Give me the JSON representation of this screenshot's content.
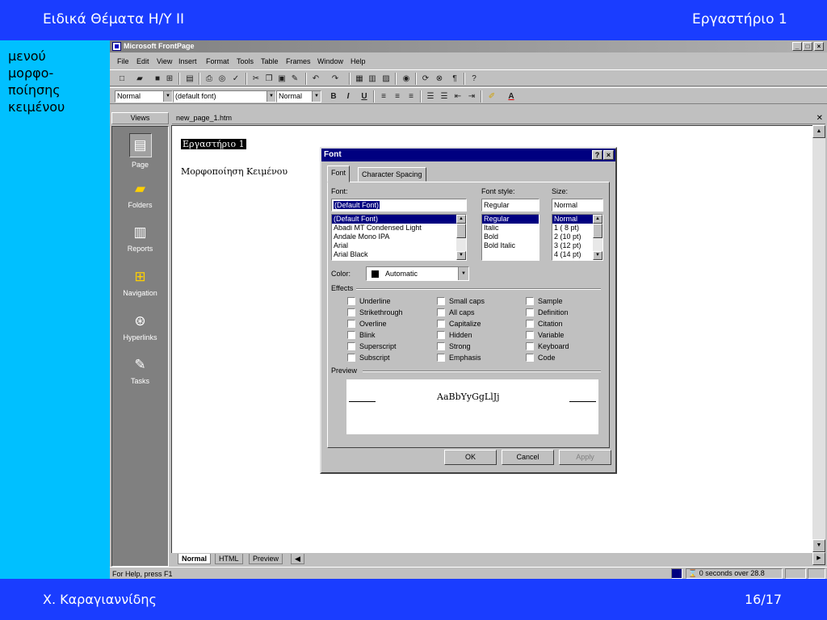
{
  "slide": {
    "header_left": "Ειδικά Θέματα Η/Υ ΙΙ",
    "header_right": "Εργαστήριο 1",
    "side_text": [
      "μενού",
      "μορφο-",
      "ποίησης",
      "κειμένου"
    ],
    "footer_left": "Χ. Καραγιαννίδης",
    "footer_right": "16/17"
  },
  "window": {
    "title": "Microsoft FrontPage",
    "controls": [
      "_",
      "□",
      "×"
    ]
  },
  "menu": [
    "File",
    "Edit",
    "View",
    "Insert",
    "Format",
    "Tools",
    "Table",
    "Frames",
    "Window",
    "Help"
  ],
  "format_toolbar": {
    "style": "Normal",
    "font": "(default font)",
    "size": "Normal",
    "bold": "B",
    "italic": "I",
    "underline": "U"
  },
  "views": {
    "header": "Views",
    "items": [
      "Page",
      "Folders",
      "Reports",
      "Navigation",
      "Hyperlinks",
      "Tasks"
    ]
  },
  "document": {
    "tab": "new_page_1.htm",
    "heading": "Εργαστήριο 1",
    "paragraph": "Μορφοποίηση Κειμένου",
    "bottom_tabs": [
      "Normal",
      "HTML",
      "Preview"
    ]
  },
  "status": {
    "help": "For Help, press F1",
    "timer": "0 seconds over 28.8"
  },
  "dialog": {
    "title": "Font",
    "tabs": [
      "Font",
      "Character Spacing"
    ],
    "font_label": "Font:",
    "font_value": "(Default Font)",
    "font_list": [
      "(Default Font)",
      "Abadi MT Condensed Light",
      "Andale Mono IPA",
      "Arial",
      "Arial Black"
    ],
    "style_label": "Font style:",
    "style_value": "Regular",
    "style_list": [
      "Regular",
      "Italic",
      "Bold",
      "Bold Italic"
    ],
    "size_label": "Size:",
    "size_value": "Normal",
    "size_list": [
      "Normal",
      "1  ( 8 pt)",
      "2  (10 pt)",
      "3  (12 pt)",
      "4  (14 pt)"
    ],
    "color_label": "Color:",
    "color_value": "Automatic",
    "effects_label": "Effects",
    "effects": [
      [
        "Underline",
        "Strikethrough",
        "Overline",
        "Blink",
        "Superscript",
        "Subscript"
      ],
      [
        "Small caps",
        "All caps",
        "Capitalize",
        "Hidden",
        "Strong",
        "Emphasis"
      ],
      [
        "Sample",
        "Definition",
        "Citation",
        "Variable",
        "Keyboard",
        "Code"
      ]
    ],
    "preview_label": "Preview",
    "preview_text": "AaBbYyGgLlJj",
    "ok": "OK",
    "cancel": "Cancel",
    "apply": "Apply"
  }
}
